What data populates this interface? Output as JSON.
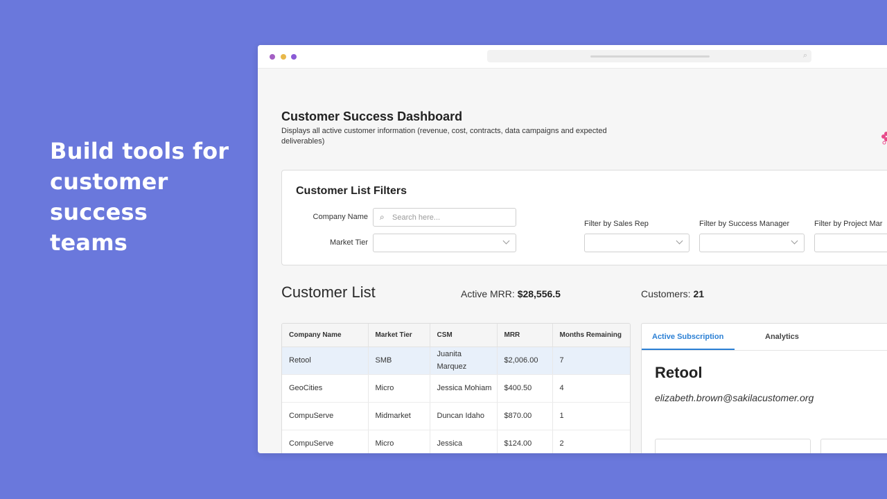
{
  "hero": {
    "headline": "Build tools for customer success teams"
  },
  "window": {
    "dot_colors": [
      "#a35fc4",
      "#e8b84a",
      "#8a5bd6"
    ],
    "url_icon": "search-icon"
  },
  "dashboard": {
    "title": "Customer Success Dashboard",
    "description": "Displays all active customer information (revenue, cost, contracts, data campaigns and expected deliverables)"
  },
  "filters": {
    "title": "Customer List Filters",
    "company_name_label": "Company Name",
    "company_name_placeholder": "Search here...",
    "market_tier_label": "Market Tier",
    "sales_rep_label": "Filter by Sales Rep",
    "success_manager_label": "Filter by Success Manager",
    "project_manager_label": "Filter by Project Mar"
  },
  "customer_list": {
    "title": "Customer List",
    "active_mrr_label": "Active MRR:",
    "active_mrr_value": "$28,556.5",
    "customers_label": "Customers:",
    "customers_value": "21"
  },
  "table": {
    "columns": [
      "Company Name",
      "Market Tier",
      "CSM",
      "MRR",
      "Months Remaining"
    ],
    "rows": [
      [
        "Retool",
        "SMB",
        "Juanita Marquez",
        "$2,006.00",
        "7"
      ],
      [
        "GeoCities",
        "Micro",
        "Jessica Mohiam",
        "$400.50",
        "4"
      ],
      [
        "CompuServe",
        "Midmarket",
        "Duncan Idaho",
        "$870.00",
        "1"
      ],
      [
        "CompuServe",
        "Micro",
        "Jessica",
        "$124.00",
        "2"
      ]
    ],
    "selected_row": 0,
    "selected_color": "#e8f0fa"
  },
  "detail": {
    "tabs": [
      "Active Subscription",
      "Analytics"
    ],
    "active_tab": 0,
    "company": "Retool",
    "email": "elizabeth.brown@sakilacustomer.org",
    "accent": "#2a7fd4"
  }
}
